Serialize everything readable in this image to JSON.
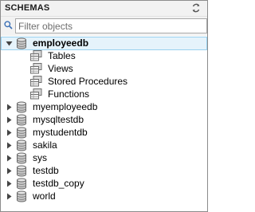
{
  "panel": {
    "title": "SCHEMAS",
    "refresh_icon": "refresh-icon",
    "filter": {
      "placeholder": "Filter objects",
      "value": "",
      "icon": "search-icon"
    }
  },
  "schemas": [
    {
      "name": "employeedb",
      "expanded": true,
      "selected": true,
      "children": [
        "Tables",
        "Views",
        "Stored Procedures",
        "Functions"
      ]
    },
    {
      "name": "myemployeedb"
    },
    {
      "name": "mysqltestdb"
    },
    {
      "name": "mystudentdb"
    },
    {
      "name": "sakila"
    },
    {
      "name": "sys"
    },
    {
      "name": "testdb"
    },
    {
      "name": "testdb_copy"
    },
    {
      "name": "world"
    }
  ],
  "colors": {
    "selection_bg": "#e5f3fb",
    "selection_border": "#99d1ef",
    "header_bg": "#f2f2f2"
  }
}
